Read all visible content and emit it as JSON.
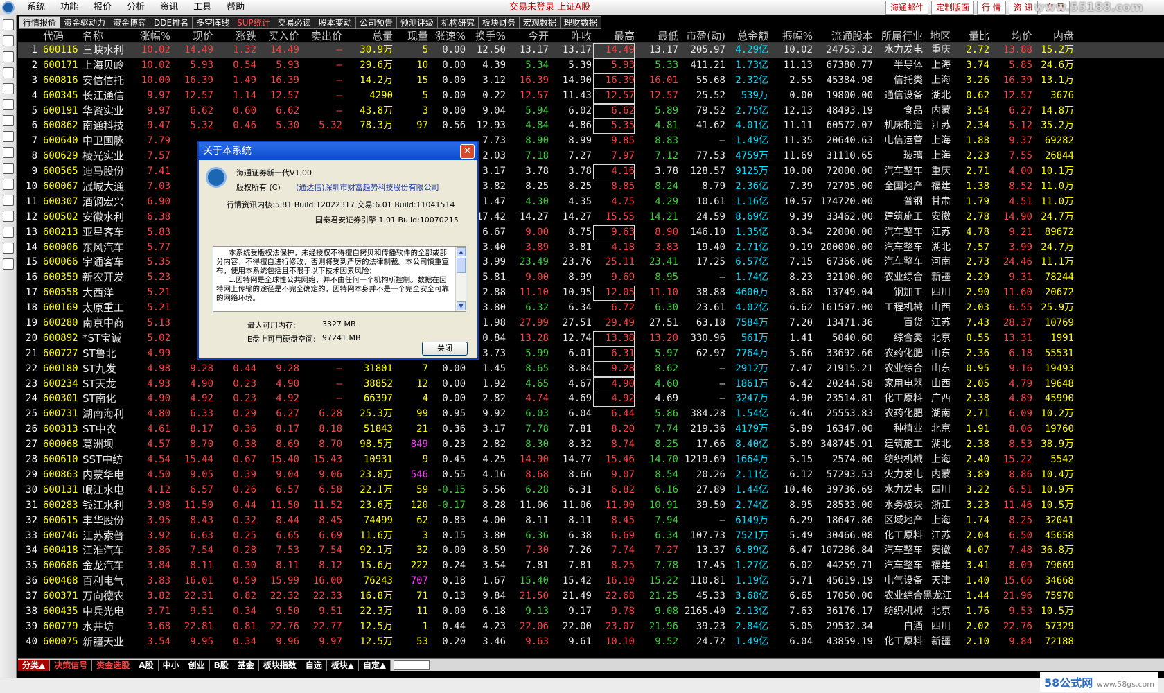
{
  "menubar": {
    "items": [
      "系统",
      "功能",
      "报价",
      "分析",
      "资讯",
      "工具",
      "帮助"
    ],
    "status_text": "交易未登录 上证A股",
    "right_buttons": [
      "海通邮件",
      "定制版面",
      "行 情",
      "资 讯",
      "交 易"
    ],
    "watermark": "www.55188.com"
  },
  "tabs": [
    "行情报价",
    "资金驱动力",
    "资金博弈",
    "DDE排名",
    "多空阵线",
    "SUP统计",
    "交易必读",
    "股本变动",
    "公司预告",
    "预测评级",
    "机构研究",
    "板块财务",
    "宏观数据",
    "理财数据"
  ],
  "highlight_tabs": [
    5
  ],
  "columns": [
    "",
    "代码",
    "名称",
    "涨幅%",
    "现价",
    "涨跌",
    "买入价",
    "卖出价",
    "总量",
    "现量",
    "涨速%",
    "换手%",
    "今开",
    "昨收",
    "最高",
    "最低",
    "市盈(动)",
    "总金额",
    "振幅%",
    "流通股本",
    "所属行业",
    "地区",
    "量比",
    "均价",
    "内盘"
  ],
  "rows": [
    [
      "1",
      "600116",
      "三峡水利",
      "10.02",
      "14.49",
      "1.32",
      "14.49",
      "—",
      "30.9万",
      "5",
      "0.00",
      "12.50",
      "13.17",
      "13.17",
      "14.49",
      "13.17",
      "205.97",
      "4.29亿",
      "10.02",
      "24753.32",
      "水力发电",
      "重庆",
      "2.72",
      "13.88",
      "15.2万"
    ],
    [
      "2",
      "600171",
      "上海贝岭",
      "10.02",
      "5.93",
      "0.54",
      "5.93",
      "—",
      "29.6万",
      "10",
      "0.00",
      "4.39",
      "5.34",
      "5.39",
      "5.93",
      "5.33",
      "411.21",
      "1.73亿",
      "11.13",
      "67380.77",
      "半导体",
      "上海",
      "3.74",
      "5.85",
      "24.6万"
    ],
    [
      "3",
      "600816",
      "安信信托",
      "10.00",
      "16.39",
      "1.49",
      "16.39",
      "—",
      "14.2万",
      "15",
      "0.00",
      "3.12",
      "16.39",
      "14.90",
      "16.39",
      "16.01",
      "55.68",
      "2.32亿",
      "2.55",
      "45384.98",
      "信托类",
      "上海",
      "3.26",
      "16.39",
      "13.1万"
    ],
    [
      "4",
      "600345",
      "长江通信",
      "9.97",
      "12.57",
      "1.14",
      "12.57",
      "—",
      "4290",
      "5",
      "0.00",
      "0.22",
      "12.57",
      "11.43",
      "12.57",
      "12.57",
      "25.52",
      "539万",
      "0.00",
      "19800.00",
      "通信设备",
      "湖北",
      "0.62",
      "12.57",
      "3676"
    ],
    [
      "5",
      "600191",
      "华资实业",
      "9.97",
      "6.62",
      "0.60",
      "6.62",
      "—",
      "43.8万",
      "3",
      "0.00",
      "9.04",
      "5.94",
      "6.02",
      "6.62",
      "5.89",
      "79.52",
      "2.75亿",
      "12.13",
      "48493.19",
      "食品",
      "内蒙",
      "3.54",
      "6.27",
      "14.8万"
    ],
    [
      "6",
      "600862",
      "南通科技",
      "9.47",
      "5.32",
      "0.46",
      "5.30",
      "5.32",
      "78.3万",
      "97",
      "0.56",
      "12.93",
      "4.84",
      "4.86",
      "5.35",
      "4.81",
      "41.62",
      "4.01亿",
      "11.11",
      "60572.07",
      "机床制造",
      "江苏",
      "2.34",
      "5.12",
      "35.2万"
    ],
    [
      "7",
      "600640",
      "中卫国脉",
      "7.79",
      "",
      "",
      "",
      "",
      "",
      "",
      "",
      "7.73",
      "8.90",
      "8.99",
      "9.85",
      "8.83",
      "—",
      "1.49亿",
      "11.35",
      "20640.63",
      "电信运营",
      "上海",
      "1.88",
      "9.37",
      "69282"
    ],
    [
      "8",
      "600629",
      "棱光实业",
      "7.57",
      "",
      "",
      "",
      "",
      "",
      "",
      "",
      "2.03",
      "7.18",
      "7.27",
      "7.97",
      "7.12",
      "77.53",
      "4759万",
      "11.69",
      "31110.65",
      "玻璃",
      "上海",
      "2.23",
      "7.55",
      "26844"
    ],
    [
      "9",
      "600565",
      "迪马股份",
      "7.41",
      "",
      "",
      "",
      "",
      "",
      "",
      "",
      "3.17",
      "3.78",
      "3.78",
      "4.16",
      "3.78",
      "128.57",
      "9125万",
      "10.00",
      "72000.00",
      "汽车整车",
      "重庆",
      "2.71",
      "4.00",
      "10.1万"
    ],
    [
      "10",
      "600067",
      "冠城大通",
      "7.03",
      "",
      "",
      "",
      "",
      "",
      "",
      "",
      "3.82",
      "8.25",
      "8.25",
      "8.85",
      "8.24",
      "8.79",
      "2.36亿",
      "7.39",
      "72705.00",
      "全国地产",
      "福建",
      "1.38",
      "8.52",
      "11.0万"
    ],
    [
      "11",
      "600307",
      "酒钢宏兴",
      "6.90",
      "",
      "",
      "",
      "",
      "",
      "",
      "",
      "1.47",
      "4.30",
      "4.35",
      "4.75",
      "4.29",
      "10.61",
      "1.16亿",
      "10.57",
      "174720.00",
      "普钢",
      "甘肃",
      "1.79",
      "4.51",
      "11.0万"
    ],
    [
      "12",
      "600502",
      "安徽水利",
      "6.38",
      "",
      "",
      "",
      "",
      "",
      "",
      "",
      "17.42",
      "14.27",
      "14.27",
      "15.55",
      "14.21",
      "24.59",
      "8.69亿",
      "9.39",
      "33462.00",
      "建筑施工",
      "安徽",
      "2.78",
      "14.90",
      "24.7万"
    ],
    [
      "13",
      "600213",
      "亚星客车",
      "5.83",
      "",
      "",
      "",
      "",
      "",
      "",
      "",
      "6.67",
      "9.00",
      "8.75",
      "9.63",
      "8.90",
      "146.10",
      "1.35亿",
      "8.34",
      "22000.00",
      "汽车整车",
      "江苏",
      "4.78",
      "9.21",
      "89672"
    ],
    [
      "14",
      "600006",
      "东风汽车",
      "5.77",
      "",
      "",
      "",
      "",
      "",
      "",
      "",
      "3.40",
      "3.89",
      "3.81",
      "4.18",
      "3.83",
      "19.40",
      "2.71亿",
      "9.19",
      "200000.00",
      "汽车整车",
      "湖北",
      "7.57",
      "3.99",
      "24.7万"
    ],
    [
      "15",
      "600066",
      "宇通客车",
      "5.35",
      "",
      "",
      "",
      "",
      "",
      "",
      "",
      "3.99",
      "23.49",
      "23.76",
      "25.11",
      "23.41",
      "17.25",
      "6.57亿",
      "7.15",
      "67366.06",
      "汽车整车",
      "河南",
      "2.73",
      "24.46",
      "11.1万"
    ],
    [
      "16",
      "600359",
      "新农开发",
      "5.23",
      "",
      "",
      "",
      "",
      "",
      "",
      "",
      "5.81",
      "9.00",
      "8.99",
      "9.69",
      "8.95",
      "—",
      "1.74亿",
      "8.23",
      "32100.00",
      "农业综合",
      "新疆",
      "2.29",
      "9.31",
      "78244"
    ],
    [
      "17",
      "600558",
      "大西洋",
      "5.21",
      "",
      "",
      "",
      "",
      "",
      "",
      "",
      "2.88",
      "11.10",
      "10.95",
      "12.05",
      "11.10",
      "38.88",
      "4600万",
      "8.68",
      "13749.04",
      "钢加工",
      "四川",
      "2.90",
      "11.60",
      "20672"
    ],
    [
      "18",
      "600169",
      "太原重工",
      "5.21",
      "",
      "",
      "",
      "",
      "",
      "",
      "",
      "3.80",
      "6.32",
      "6.34",
      "6.72",
      "6.30",
      "23.61",
      "4.02亿",
      "6.62",
      "161597.00",
      "工程机械",
      "山西",
      "2.03",
      "6.55",
      "25.9万"
    ],
    [
      "19",
      "600280",
      "南京中商",
      "5.13",
      "",
      "",
      "",
      "",
      "",
      "",
      "",
      "1.98",
      "27.99",
      "27.51",
      "29.49",
      "27.51",
      "63.18",
      "7584万",
      "7.20",
      "13471.36",
      "百货",
      "江苏",
      "7.43",
      "28.37",
      "10769"
    ],
    [
      "20",
      "600892",
      "*ST宝诚",
      "5.02",
      "",
      "",
      "",
      "",
      "",
      "",
      "",
      "0.84",
      "13.28",
      "12.74",
      "13.38",
      "13.20",
      "330.96",
      "561万",
      "1.41",
      "5040.60",
      "综合类",
      "北京",
      "0.55",
      "13.31",
      "1991"
    ],
    [
      "21",
      "600727",
      "ST鲁北",
      "4.99",
      "",
      "",
      "",
      "",
      "",
      "",
      "",
      "3.73",
      "5.99",
      "6.01",
      "6.31",
      "5.97",
      "62.97",
      "7764万",
      "5.66",
      "33692.66",
      "农药化肥",
      "山东",
      "2.36",
      "6.18",
      "55531"
    ],
    [
      "22",
      "600180",
      "ST九发",
      "4.98",
      "9.28",
      "0.44",
      "9.28",
      "—",
      "31801",
      "7",
      "0.00",
      "1.45",
      "8.65",
      "8.84",
      "9.28",
      "8.62",
      "—",
      "2912万",
      "7.47",
      "21915.21",
      "农业综合",
      "山东",
      "0.95",
      "9.16",
      "19493"
    ],
    [
      "23",
      "600234",
      "ST天龙",
      "4.93",
      "4.90",
      "0.23",
      "4.90",
      "—",
      "38852",
      "12",
      "0.00",
      "1.92",
      "4.65",
      "4.67",
      "4.90",
      "4.60",
      "—",
      "1861万",
      "6.42",
      "20244.58",
      "家用电器",
      "山西",
      "2.05",
      "4.79",
      "19648"
    ],
    [
      "24",
      "600301",
      "ST南化",
      "4.90",
      "4.92",
      "0.23",
      "4.92",
      "—",
      "66397",
      "4",
      "0.00",
      "2.82",
      "4.74",
      "4.69",
      "4.92",
      "4.69",
      "—",
      "3247万",
      "4.90",
      "23514.81",
      "化工原料",
      "广西",
      "2.38",
      "4.89",
      "45990"
    ],
    [
      "25",
      "600731",
      "湖南海利",
      "4.80",
      "6.33",
      "0.29",
      "6.27",
      "6.28",
      "25.3万",
      "99",
      "0.95",
      "9.92",
      "6.03",
      "6.04",
      "6.44",
      "5.86",
      "384.28",
      "1.54亿",
      "6.46",
      "25553.83",
      "农药化肥",
      "湖南",
      "2.71",
      "6.09",
      "10.2万"
    ],
    [
      "26",
      "600313",
      "ST中农",
      "4.61",
      "8.17",
      "0.36",
      "8.17",
      "8.18",
      "51843",
      "21",
      "0.36",
      "3.17",
      "7.78",
      "7.81",
      "8.20",
      "7.74",
      "219.36",
      "4179万",
      "5.89",
      "16347.00",
      "种植业",
      "北京",
      "1.91",
      "8.06",
      "19760"
    ],
    [
      "27",
      "600068",
      "葛洲坝",
      "4.57",
      "8.70",
      "0.38",
      "8.69",
      "8.70",
      "98.5万",
      "849",
      "0.23",
      "2.82",
      "8.30",
      "8.32",
      "8.74",
      "8.25",
      "17.66",
      "8.40亿",
      "5.89",
      "348745.91",
      "建筑施工",
      "湖北",
      "2.38",
      "8.53",
      "38.9万"
    ],
    [
      "28",
      "600610",
      "SST中纺",
      "4.54",
      "15.44",
      "0.67",
      "15.40",
      "15.43",
      "10931",
      "9",
      "0.45",
      "4.25",
      "14.90",
      "14.77",
      "15.46",
      "14.70",
      "1219.69",
      "1664万",
      "5.15",
      "2574.00",
      "纺织机械",
      "上海",
      "2.40",
      "15.22",
      "5542"
    ],
    [
      "29",
      "600863",
      "内蒙华电",
      "4.50",
      "9.05",
      "0.39",
      "9.04",
      "9.06",
      "23.8万",
      "546",
      "0.55",
      "4.16",
      "8.68",
      "8.66",
      "9.07",
      "8.54",
      "20.26",
      "2.11亿",
      "6.12",
      "57293.53",
      "火力发电",
      "内蒙",
      "3.89",
      "8.86",
      "10.4万"
    ],
    [
      "30",
      "600131",
      "岷江水电",
      "4.12",
      "6.57",
      "0.26",
      "6.57",
      "6.58",
      "22.1万",
      "59",
      "-0.15",
      "5.56",
      "6.28",
      "6.31",
      "6.82",
      "6.16",
      "27.89",
      "1.44亿",
      "10.46",
      "39736.69",
      "水力发电",
      "四川",
      "3.22",
      "6.51",
      "10.9万"
    ],
    [
      "31",
      "600283",
      "钱江水利",
      "3.98",
      "11.50",
      "0.44",
      "11.50",
      "11.52",
      "23.6万",
      "120",
      "-0.17",
      "8.28",
      "11.06",
      "11.06",
      "11.90",
      "10.91",
      "39.50",
      "2.74亿",
      "8.95",
      "28533.00",
      "水务板块",
      "浙江",
      "3.23",
      "11.46",
      "10.5万"
    ],
    [
      "32",
      "600615",
      "丰华股份",
      "3.95",
      "8.43",
      "0.32",
      "8.44",
      "8.45",
      "74499",
      "62",
      "0.83",
      "4.00",
      "8.11",
      "8.11",
      "8.45",
      "7.94",
      "—",
      "6149万",
      "6.29",
      "18647.86",
      "区域地产",
      "上海",
      "1.74",
      "8.25",
      "32041"
    ],
    [
      "33",
      "600746",
      "江苏索普",
      "3.92",
      "6.63",
      "0.25",
      "6.65",
      "6.69",
      "11.6万",
      "3",
      "0.15",
      "3.80",
      "6.36",
      "6.38",
      "6.69",
      "6.34",
      "107.73",
      "7521万",
      "5.49",
      "30466.08",
      "化工原料",
      "江苏",
      "2.04",
      "6.50",
      "45658"
    ],
    [
      "34",
      "600418",
      "江淮汽车",
      "3.86",
      "7.54",
      "0.28",
      "7.53",
      "7.54",
      "92.1万",
      "32",
      "0.00",
      "8.59",
      "7.30",
      "7.26",
      "7.74",
      "7.27",
      "13.37",
      "6.89亿",
      "6.47",
      "107286.84",
      "汽车整车",
      "安徽",
      "4.07",
      "7.48",
      "36.8万"
    ],
    [
      "35",
      "600686",
      "金龙汽车",
      "3.84",
      "8.11",
      "0.30",
      "8.11",
      "8.12",
      "15.6万",
      "222",
      "0.24",
      "3.54",
      "7.81",
      "7.81",
      "8.25",
      "7.78",
      "17.45",
      "1.27亿",
      "6.02",
      "44259.71",
      "汽车整车",
      "福建",
      "3.41",
      "8.09",
      "79669"
    ],
    [
      "36",
      "600468",
      "百利电气",
      "3.83",
      "16.01",
      "0.59",
      "15.99",
      "16.00",
      "76243",
      "707",
      "0.18",
      "1.67",
      "15.40",
      "15.42",
      "16.10",
      "15.22",
      "110.81",
      "1.19亿",
      "5.71",
      "45619.19",
      "电气设备",
      "天津",
      "1.40",
      "15.66",
      "34668"
    ],
    [
      "37",
      "600371",
      "万向德农",
      "3.82",
      "22.31",
      "0.82",
      "22.32",
      "22.33",
      "16.8万",
      "71",
      "0.13",
      "9.84",
      "21.50",
      "21.49",
      "22.68",
      "21.25",
      "45.33",
      "3.68亿",
      "6.65",
      "17050.00",
      "农业综合",
      "黑龙江",
      "1.44",
      "21.96",
      "75970"
    ],
    [
      "38",
      "600435",
      "中兵光电",
      "3.71",
      "9.51",
      "0.34",
      "9.50",
      "9.51",
      "22.3万",
      "11",
      "0.00",
      "6.18",
      "9.13",
      "9.17",
      "9.78",
      "9.08",
      "2165.40",
      "2.13亿",
      "7.63",
      "36176.17",
      "纺织机械",
      "北京",
      "1.76",
      "9.53",
      "10.5万"
    ],
    [
      "39",
      "600779",
      "水井坊",
      "3.68",
      "22.81",
      "0.81",
      "22.76",
      "22.77",
      "12.5万",
      "1",
      "0.44",
      "4.23",
      "22.06",
      "22.00",
      "23.07",
      "21.96",
      "39.23",
      "2.84亿",
      "5.05",
      "29532.34",
      "白酒",
      "四川",
      "2.02",
      "22.76",
      "57329"
    ],
    [
      "40",
      "600075",
      "新疆天业",
      "3.54",
      "9.95",
      "0.34",
      "9.96",
      "9.97",
      "12.5万",
      "53",
      "0.20",
      "3.46",
      "9.63",
      "9.61",
      "10.10",
      "9.52",
      "24.72",
      "1.49亿",
      "6.04",
      "43859.19",
      "化工原料",
      "新疆",
      "2.10",
      "9.84",
      "72188"
    ]
  ],
  "dialog": {
    "title": "关于本系统",
    "product": "海通证券新一代V1.00",
    "copyright_label": "版权所有 (C)",
    "copyright_holder": "(通达信)深圳市财富趋势科技股份有限公司",
    "version_line": "行情资讯内核:5.81 Build:12022317 交易:6.01 Build:11041514",
    "engine_line": "国泰君安证券引擎 1.01 Build:10070215",
    "notice_p1": "本系统受版权法保护，未经授权不得擅自拷贝和传播软件的全部或部分内容，不得擅自进行修改，否则将受到严厉的法律制裁。本公司慎重宣布，使用本系统包括且不限于以下技术因素风险：",
    "notice_p2": "1.因特网是全球性公共网络，并不由任何一个机构所控制。数据在因特网上传输的途径是不完全确定的，因特网本身并不是一个完全安全可靠的网络环境。",
    "mem_label": "最大可用内存:",
    "mem_value": "3327 MB",
    "disk_label": "E盘上可用硬盘空间:",
    "disk_value": "97241 MB",
    "close_button": "关闭"
  },
  "bottom_tabs": [
    "分类▲",
    "决策信号",
    "资金选股",
    "A股",
    "中小",
    "创业",
    "B股",
    "基金",
    "板块指数",
    "自选",
    "板块▲",
    "自定▲"
  ],
  "toolbar_icons": [
    "quote-icon",
    "list-icon",
    "chart-icon",
    "kline-icon",
    "f10-icon",
    "report-icon",
    "info-icon",
    "lock-icon",
    "fin-icon",
    "f10-info-icon",
    "search-icon",
    "folder-icon",
    "signal-icon",
    "settings-icon",
    "etf-icon",
    "export-icon"
  ],
  "watermark_bottom": "58公式网",
  "watermark_bottom_url": "www.58gs.com",
  "colors": {
    "up": "#ff4040",
    "down": "#3cd03c",
    "code": "#ffff00",
    "money": "#00e0ff",
    "background": "#000000"
  }
}
